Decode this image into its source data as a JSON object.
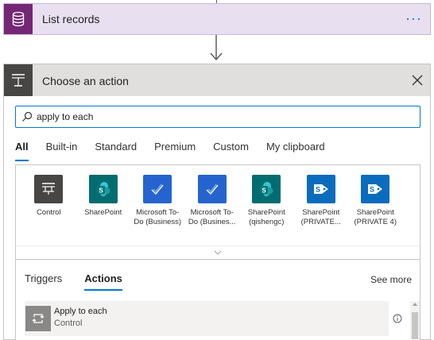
{
  "list_records": {
    "title": "List records",
    "more": "···"
  },
  "action_panel": {
    "title": "Choose an action",
    "search": {
      "value": "apply to each",
      "placeholder": ""
    },
    "tabs": [
      {
        "label": "All"
      },
      {
        "label": "Built-in"
      },
      {
        "label": "Standard"
      },
      {
        "label": "Premium"
      },
      {
        "label": "Custom"
      },
      {
        "label": "My clipboard"
      }
    ],
    "connectors": [
      {
        "label": "Control",
        "icon": "control-icon",
        "color": "#484644"
      },
      {
        "label": "SharePoint",
        "icon": "sharepoint-icon",
        "color": "#036c70"
      },
      {
        "label": "Microsoft To-Do (Business)",
        "icon": "todo-icon",
        "color": "#2564cf"
      },
      {
        "label": "Microsoft To-Do (Busines...",
        "icon": "todo-icon",
        "color": "#2564cf"
      },
      {
        "label": "SharePoint (qishengc)",
        "icon": "sharepoint-icon",
        "color": "#036c70"
      },
      {
        "label": "SharePoint (PRIVATE...",
        "icon": "sharepoint-private-icon",
        "color": "#0b6cbd"
      },
      {
        "label": "SharePoint (PRIVATE 4)",
        "icon": "sharepoint-private-icon",
        "color": "#0b6cbd"
      }
    ],
    "result_tabs": [
      {
        "label": "Triggers"
      },
      {
        "label": "Actions"
      }
    ],
    "see_more": "See more",
    "results": [
      {
        "name": "Apply to each",
        "connector": "Control",
        "icon": "loop-icon"
      }
    ]
  },
  "colors": {
    "accent": "#0078d4",
    "dataverse": "#742774"
  }
}
